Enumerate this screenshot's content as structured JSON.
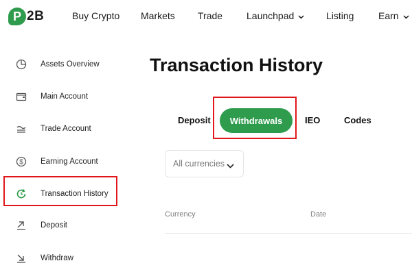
{
  "logo": {
    "badge": "P",
    "text": "2B"
  },
  "nav": {
    "items": [
      {
        "label": "Buy Crypto"
      },
      {
        "label": "Markets"
      },
      {
        "label": "Trade"
      },
      {
        "label": "Launchpad",
        "has_dropdown": true
      },
      {
        "label": "Listing"
      },
      {
        "label": "Earn",
        "has_dropdown": true
      }
    ]
  },
  "sidebar": {
    "items": [
      {
        "label": "Assets Overview",
        "icon": "pie-chart-icon"
      },
      {
        "label": "Main Account",
        "icon": "wallet-icon"
      },
      {
        "label": "Trade Account",
        "icon": "trade-lines-icon"
      },
      {
        "label": "Earning Account",
        "icon": "dollar-circle-icon"
      },
      {
        "label": "Transaction History",
        "icon": "refresh-icon",
        "active": true
      },
      {
        "label": "Deposit",
        "icon": "arrow-up-right-icon"
      },
      {
        "label": "Withdraw",
        "icon": "arrow-down-right-icon"
      }
    ]
  },
  "main": {
    "title": "Transaction History",
    "tabs": [
      {
        "label": "Deposit"
      },
      {
        "label": "Withdrawals",
        "active": true
      },
      {
        "label": "IEO"
      },
      {
        "label": "Codes"
      }
    ],
    "filter": {
      "value": "All currencies"
    },
    "table": {
      "headers": [
        "Currency",
        "Date"
      ]
    }
  },
  "colors": {
    "brand": "#2e9b4d",
    "highlight": "#e0161b"
  }
}
